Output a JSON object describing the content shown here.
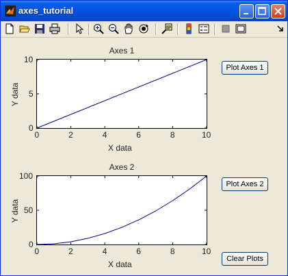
{
  "window": {
    "title": "axes_tutorial"
  },
  "toolbar": {
    "tools": [
      "new-file-icon",
      "open-folder-icon",
      "save-icon",
      "print-icon",
      "select-arrow-icon",
      "zoom-in-icon",
      "zoom-out-icon",
      "pan-hand-icon",
      "rotate-3d-icon",
      "data-cursor-icon",
      "colorbar-icon",
      "legend-icon",
      "hide-plot-tools-icon",
      "show-plot-tools-icon",
      "dock-arrow-icon"
    ]
  },
  "buttons": {
    "plot_axes_1": "Plot Axes 1",
    "plot_axes_2": "Plot Axes 2",
    "clear_plots": "Clear Plots"
  },
  "chart_data": [
    {
      "type": "line",
      "title": "Axes 1",
      "xlabel": "X data",
      "ylabel": "Y data",
      "xlim": [
        0,
        10
      ],
      "ylim": [
        0,
        10
      ],
      "xticks": [
        0,
        2,
        4,
        6,
        8,
        10
      ],
      "yticks": [
        0,
        5,
        10
      ],
      "series": [
        {
          "x": [
            0,
            10
          ],
          "y": [
            0,
            10
          ],
          "color": "#00008b"
        }
      ]
    },
    {
      "type": "line",
      "title": "Axes 2",
      "xlabel": "X data",
      "ylabel": "Y data",
      "xlim": [
        0,
        10
      ],
      "ylim": [
        0,
        100
      ],
      "xticks": [
        0,
        2,
        4,
        6,
        8,
        10
      ],
      "yticks": [
        0,
        50,
        100
      ],
      "series": [
        {
          "x": [
            0,
            1,
            2,
            3,
            4,
            5,
            6,
            7,
            8,
            9,
            10
          ],
          "y": [
            0,
            1,
            4,
            9,
            16,
            25,
            36,
            49,
            64,
            81,
            100
          ],
          "color": "#00008b"
        }
      ]
    }
  ]
}
